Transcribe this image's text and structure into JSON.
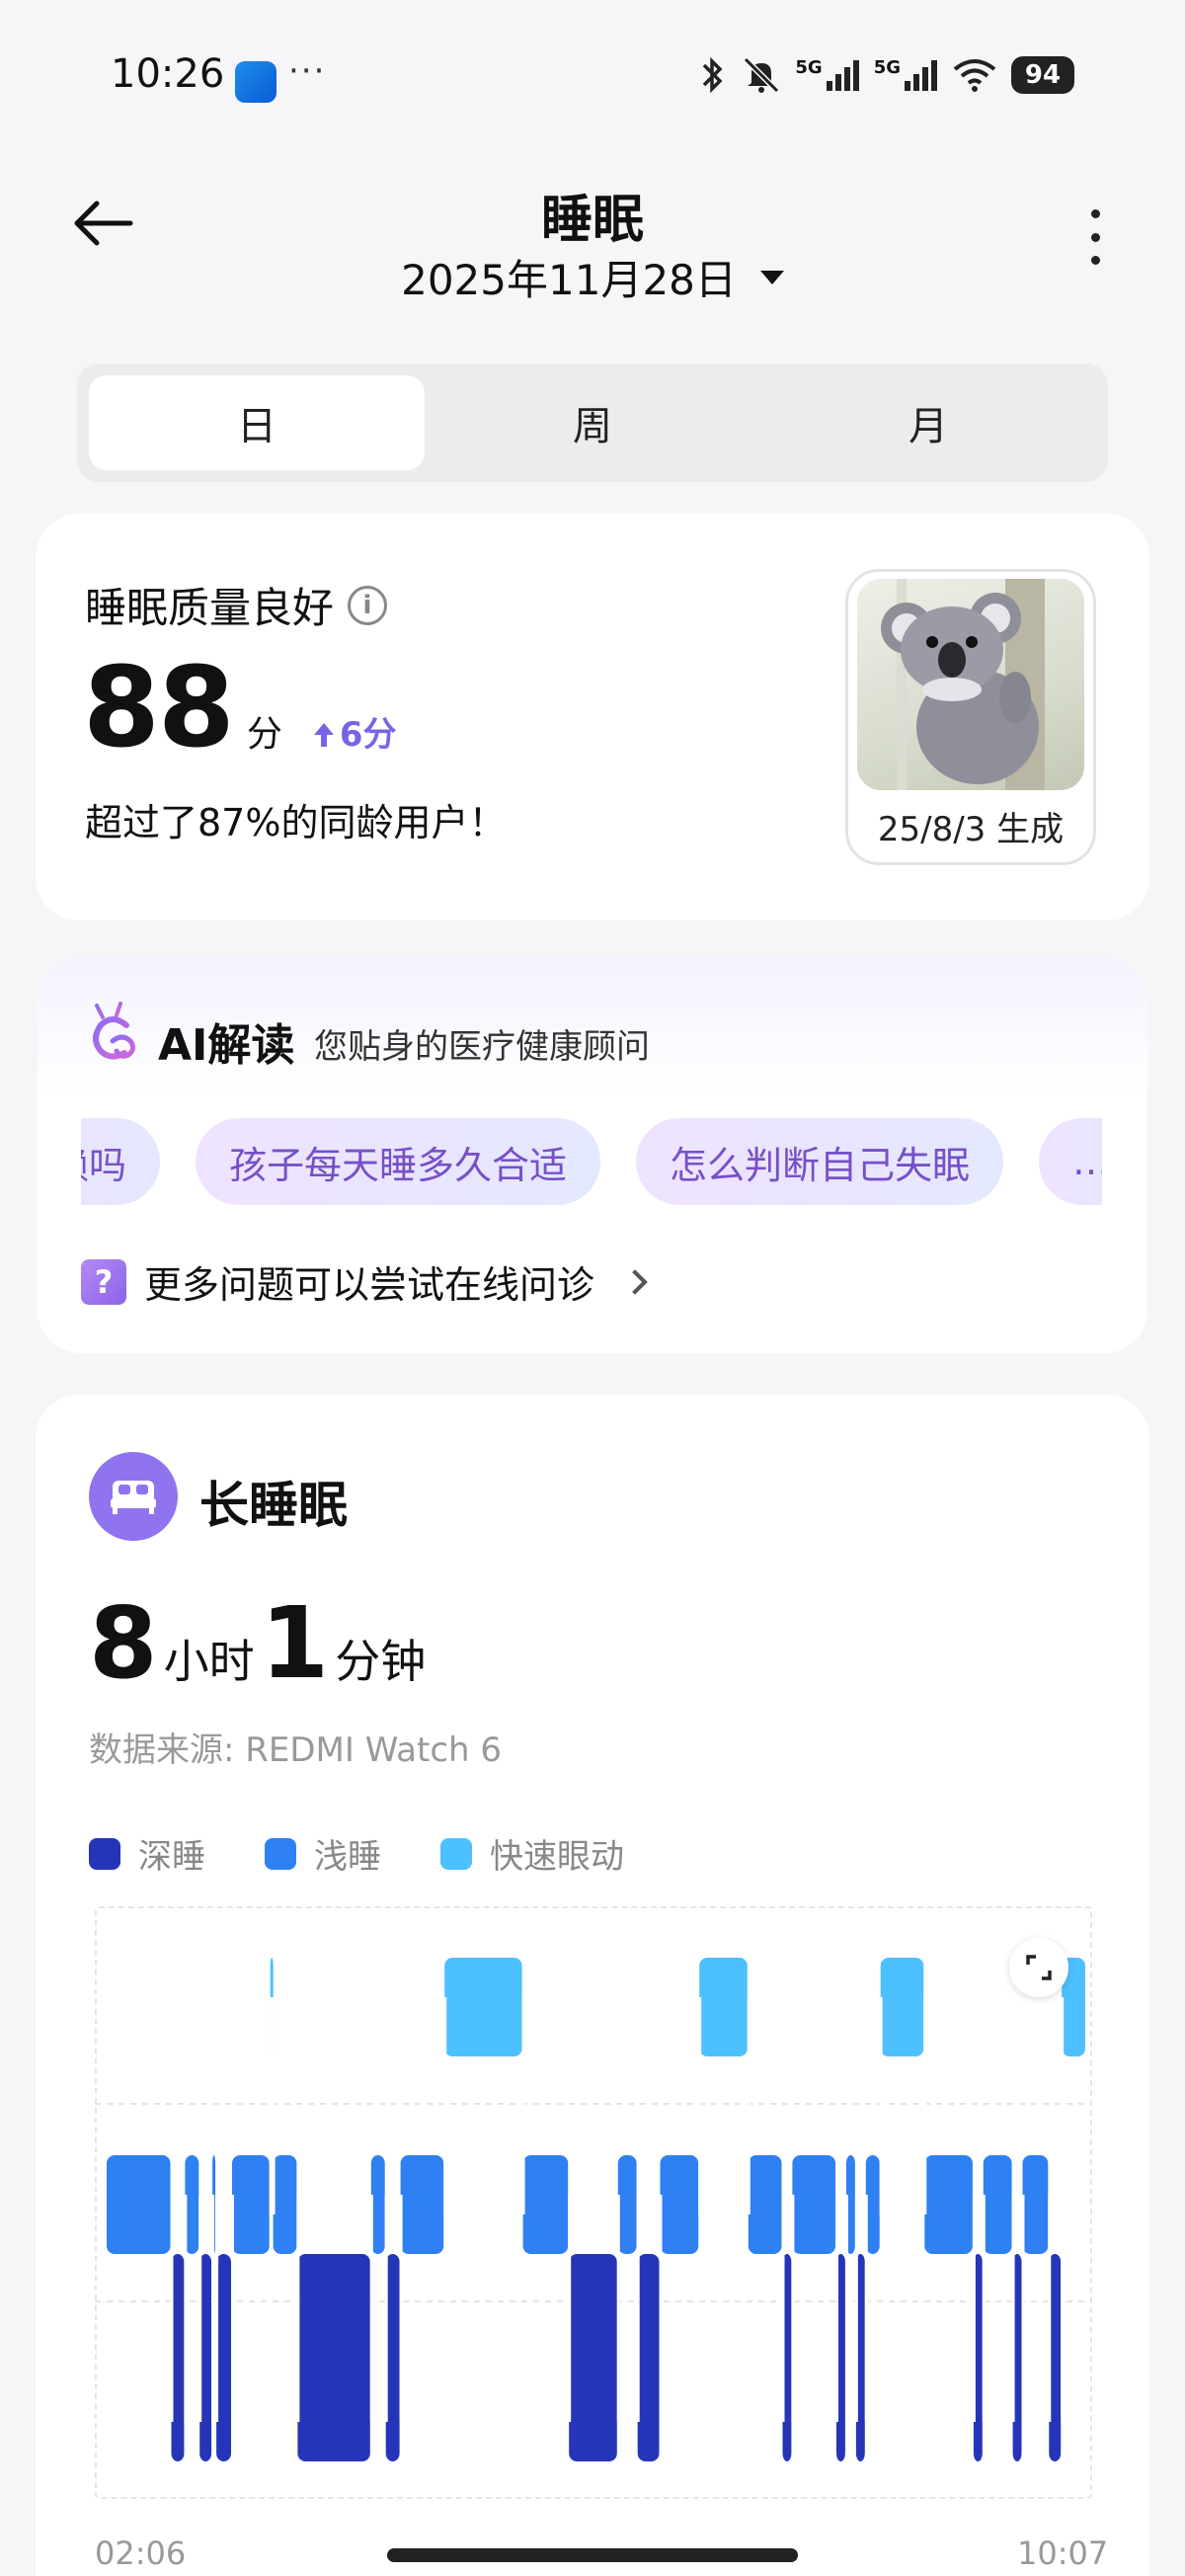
{
  "status_bar": {
    "time": "10:26",
    "dots": "···",
    "network_1": "5G",
    "network_2": "5G",
    "battery": "94",
    "icons": [
      "app-icon",
      "bluetooth-icon",
      "mute-icon",
      "signal-icon",
      "signal-icon",
      "wifi-icon",
      "battery-icon"
    ]
  },
  "header": {
    "title": "睡眠",
    "date": "2025年11月28日"
  },
  "tabs": [
    {
      "label": "日",
      "active": true
    },
    {
      "label": "周",
      "active": false
    },
    {
      "label": "月",
      "active": false
    }
  ],
  "quality": {
    "label": "睡眠质量良好",
    "score": "88",
    "unit": "分",
    "delta": "6分",
    "percentile": "超过了87%的同龄用户！",
    "image_date": "25/8/3 生成"
  },
  "ai": {
    "title": "AI解读",
    "subtitle": "您贴身的医疗健康顾问",
    "chips": [
      "赖吗",
      "孩子每天睡多久合适",
      "怎么判断自己失眠",
      "…"
    ],
    "more_questions": "更多问题可以尝试在线问诊"
  },
  "sleep": {
    "title": "长睡眠",
    "hours": "8",
    "hours_unit": "小时",
    "minutes": "1",
    "minutes_unit": "分钟",
    "source": "数据来源: REDMI Watch 6",
    "legend": [
      {
        "label": "深睡",
        "color": "#2435b8"
      },
      {
        "label": "浅睡",
        "color": "#2f80f2"
      },
      {
        "label": "快速眼动",
        "color": "#4dc0ff"
      }
    ],
    "start_time": "02:06",
    "end_time": "10:07"
  },
  "chart_data": {
    "type": "area",
    "stages": [
      "deep",
      "light",
      "rem",
      "awake"
    ],
    "x_range": [
      "02:06",
      "10:07"
    ],
    "segments": [
      {
        "start": 0.0,
        "end": 0.066,
        "stage": "light"
      },
      {
        "start": 0.066,
        "end": 0.08,
        "stage": "deep"
      },
      {
        "start": 0.08,
        "end": 0.095,
        "stage": "light"
      },
      {
        "start": 0.095,
        "end": 0.108,
        "stage": "deep"
      },
      {
        "start": 0.108,
        "end": 0.112,
        "stage": "light"
      },
      {
        "start": 0.112,
        "end": 0.128,
        "stage": "deep"
      },
      {
        "start": 0.128,
        "end": 0.167,
        "stage": "light"
      },
      {
        "start": 0.167,
        "end": 0.17,
        "stage": "rem"
      },
      {
        "start": 0.17,
        "end": 0.195,
        "stage": "light"
      },
      {
        "start": 0.195,
        "end": 0.27,
        "stage": "deep"
      },
      {
        "start": 0.27,
        "end": 0.285,
        "stage": "light"
      },
      {
        "start": 0.285,
        "end": 0.3,
        "stage": "deep"
      },
      {
        "start": 0.3,
        "end": 0.345,
        "stage": "light"
      },
      {
        "start": 0.345,
        "end": 0.425,
        "stage": "rem"
      },
      {
        "start": 0.425,
        "end": 0.472,
        "stage": "light"
      },
      {
        "start": 0.472,
        "end": 0.522,
        "stage": "deep"
      },
      {
        "start": 0.522,
        "end": 0.542,
        "stage": "light"
      },
      {
        "start": 0.542,
        "end": 0.565,
        "stage": "deep"
      },
      {
        "start": 0.565,
        "end": 0.605,
        "stage": "light"
      },
      {
        "start": 0.605,
        "end": 0.655,
        "stage": "rem"
      },
      {
        "start": 0.655,
        "end": 0.69,
        "stage": "light"
      },
      {
        "start": 0.69,
        "end": 0.7,
        "stage": "deep"
      },
      {
        "start": 0.7,
        "end": 0.745,
        "stage": "light"
      },
      {
        "start": 0.745,
        "end": 0.755,
        "stage": "deep"
      },
      {
        "start": 0.755,
        "end": 0.765,
        "stage": "light"
      },
      {
        "start": 0.765,
        "end": 0.775,
        "stage": "deep"
      },
      {
        "start": 0.775,
        "end": 0.79,
        "stage": "light"
      },
      {
        "start": 0.79,
        "end": 0.835,
        "stage": "rem"
      },
      {
        "start": 0.835,
        "end": 0.885,
        "stage": "light"
      },
      {
        "start": 0.885,
        "end": 0.895,
        "stage": "deep"
      },
      {
        "start": 0.895,
        "end": 0.925,
        "stage": "light"
      },
      {
        "start": 0.925,
        "end": 0.935,
        "stage": "deep"
      },
      {
        "start": 0.935,
        "end": 0.962,
        "stage": "light"
      },
      {
        "start": 0.962,
        "end": 0.975,
        "stage": "deep"
      },
      {
        "start": 0.975,
        "end": 1.0,
        "stage": "rem"
      }
    ]
  }
}
